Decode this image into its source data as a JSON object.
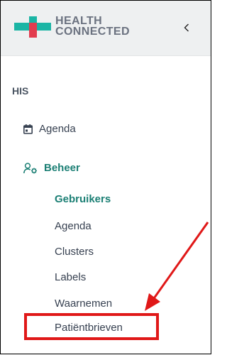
{
  "brand": {
    "line1": "HEALTH",
    "line2": "CONNECTED",
    "logo_colors": [
      "#1bb5a5",
      "#e23d4f"
    ]
  },
  "collapse_icon": "chevron-left-icon",
  "section": {
    "title": "HIS"
  },
  "nav": [
    {
      "label": "Agenda",
      "icon": "calendar-icon",
      "active": false
    },
    {
      "label": "Beheer",
      "icon": "users-gear-icon",
      "active": true
    }
  ],
  "beheer_items": [
    {
      "label": "Gebruikers",
      "active": true
    },
    {
      "label": "Agenda",
      "active": false
    },
    {
      "label": "Clusters",
      "active": false
    },
    {
      "label": "Labels",
      "active": false
    },
    {
      "label": "Waarnemen",
      "active": false
    },
    {
      "label": "Patiëntbrieven",
      "active": false,
      "highlighted": true
    }
  ],
  "colors": {
    "accent": "#1b7f74",
    "annotation": "#e01818"
  }
}
